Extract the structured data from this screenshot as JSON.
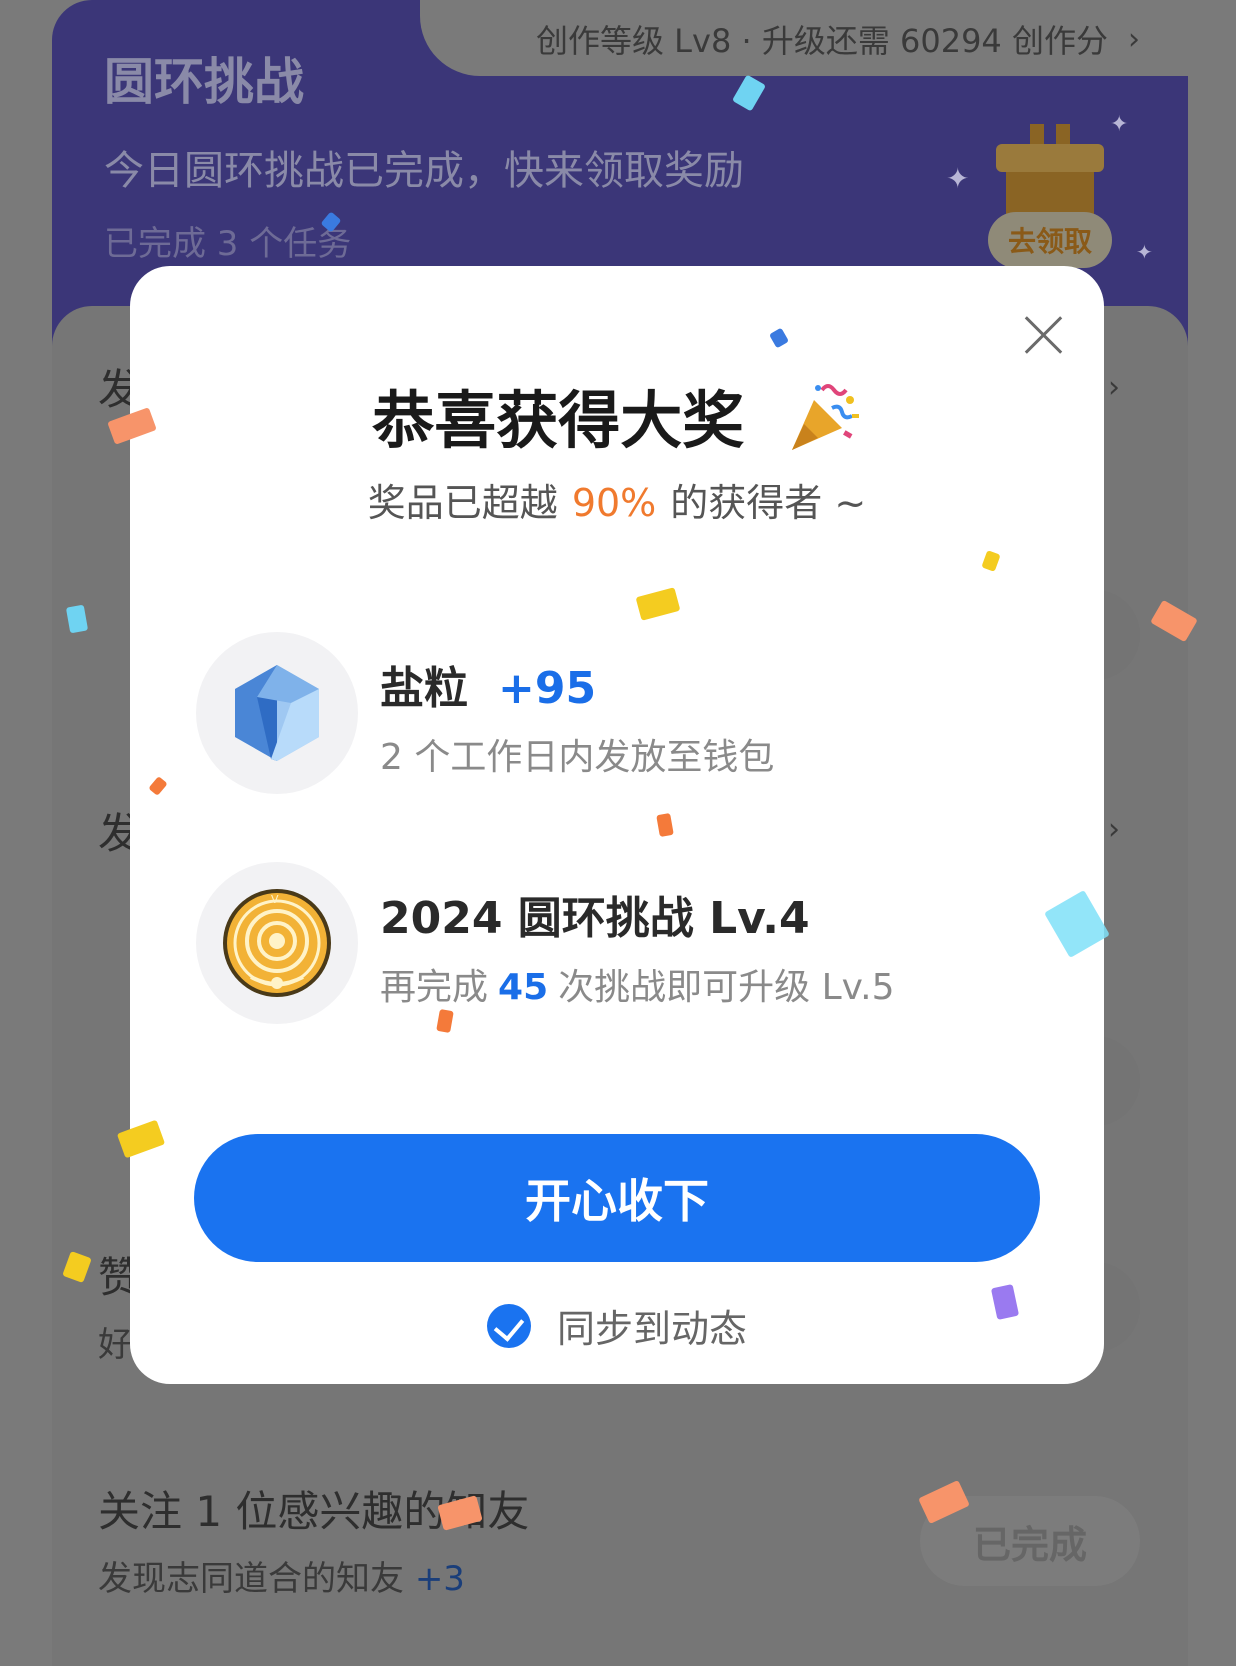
{
  "header": {
    "level_text": "创作等级 Lv8 · 升级还需 60294 创作分",
    "title": "圆环挑战",
    "subtitle": "今日圆环挑战已完成，快来领取奖励",
    "completed_count": "已完成 3 个任务",
    "claim_label": "去领取"
  },
  "tasks": [
    {
      "title": "发",
      "desc": ""
    },
    {
      "title": "发",
      "desc": ""
    },
    {
      "title": "赞",
      "desc": "好"
    },
    {
      "title": "关注 1 位感兴趣的知友",
      "desc": "发现志同道合的知友",
      "plus": "+3",
      "status": "已完成"
    }
  ],
  "modal": {
    "title": "恭喜获得大奖",
    "subtitle_prefix": "奖品已超越",
    "subtitle_pct": "90%",
    "subtitle_suffix": "的获得者 ~",
    "rewards": [
      {
        "name": "盐粒",
        "amount": "+95",
        "desc": "2 个工作日内发放至钱包",
        "icon": "salt-crystal-icon"
      },
      {
        "name": "2024 圆环挑战 Lv.4",
        "desc_prefix": "再完成",
        "desc_num": "45",
        "desc_suffix": "次挑战即可升级 Lv.5",
        "icon": "ring-medal-icon"
      }
    ],
    "accept_label": "开心收下",
    "sync_label": "同步到动态",
    "sync_checked": true
  },
  "colors": {
    "accent": "#1a73f0",
    "highlight": "#f07a2e",
    "header_bg": "#3b3678"
  }
}
